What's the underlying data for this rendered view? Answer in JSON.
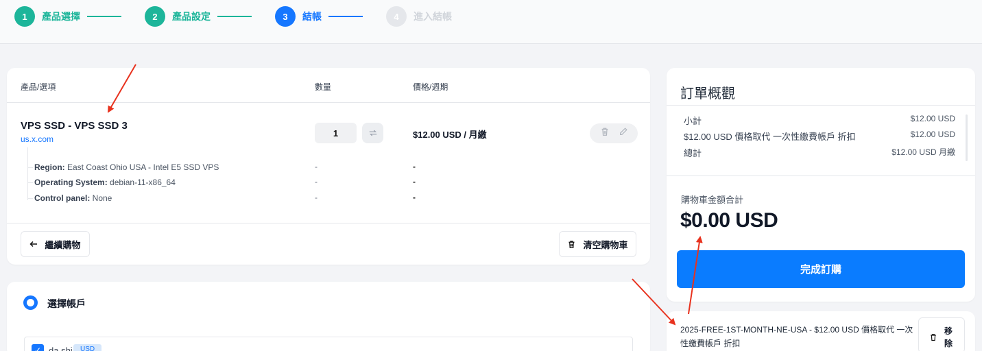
{
  "stepper": [
    {
      "num": "1",
      "label": "產品選擇"
    },
    {
      "num": "2",
      "label": "產品設定"
    },
    {
      "num": "3",
      "label": "結帳"
    },
    {
      "num": "4",
      "label": "進入結帳"
    }
  ],
  "cart": {
    "headers": {
      "product": "產品/選項",
      "qty": "數量",
      "price": "價格/週期"
    },
    "item": {
      "name": "VPS SSD - VPS SSD 3",
      "domain": "us.x.com",
      "quantity": "1",
      "price": "$12.00 USD / 月繳",
      "options": [
        {
          "key": "Region:",
          "value": " East Coast Ohio USA - Intel E5 SSD VPS",
          "qty": "-",
          "price": "-"
        },
        {
          "key": "Operating System:",
          "value": " debian-11-x86_64",
          "qty": "-",
          "price": "-"
        },
        {
          "key": "Control panel:",
          "value": " None",
          "qty": "-",
          "price": "-"
        }
      ]
    },
    "continue_label": "繼續購物",
    "clear_label": "清空購物車"
  },
  "account": {
    "title": "選擇帳戶",
    "name": "da.shi",
    "badge": "USD"
  },
  "summary": {
    "title": "訂單概觀",
    "rows": [
      {
        "label": "小計",
        "value": "$12.00 USD"
      },
      {
        "label": "$12.00 USD 價格取代 一次性繳費帳戶 折扣",
        "value": "$12.00 USD"
      },
      {
        "label": "總計",
        "value": "$12.00 USD 月繳"
      }
    ],
    "cart_total_label": "購物車金額合計",
    "cart_total": "$0.00 USD",
    "checkout_label": "完成訂購",
    "promo": "2025-FREE-1ST-MONTH-NE-USA - $12.00 USD 價格取代 一次性繳費帳戶 折扣",
    "remove_label": "移除"
  },
  "colors": {
    "primary": "#1677ff",
    "success": "#1db59a",
    "annotation": "#e8321e"
  }
}
